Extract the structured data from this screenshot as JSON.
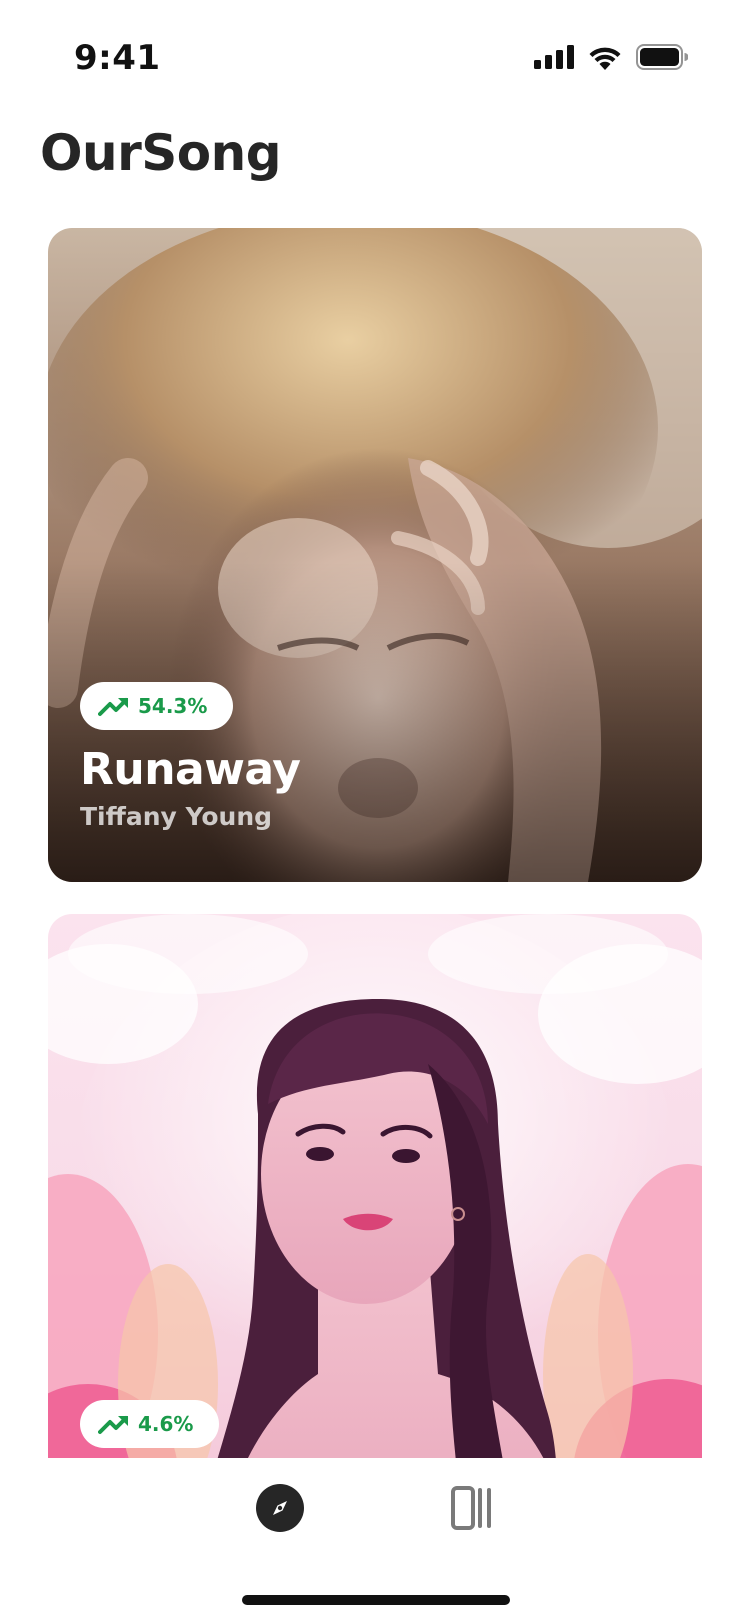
{
  "status_bar": {
    "time": "9:41",
    "icons": [
      "cellular-signal-icon",
      "wifi-icon",
      "battery-icon"
    ]
  },
  "app": {
    "title": "OurSong"
  },
  "cards": [
    {
      "title": "Runaway",
      "artist": "Tiffany Young",
      "trend": "54.3%",
      "trend_icon": "trending-up-icon",
      "artwork": "album-artwork-photo"
    },
    {
      "trend": "4.6%",
      "trend_icon": "trending-up-icon",
      "artwork": "album-artwork-illustration"
    }
  ],
  "tab_bar": {
    "items": [
      {
        "icon": "compass-icon",
        "active": true
      },
      {
        "icon": "library-icon",
        "active": false
      }
    ]
  },
  "colors": {
    "trend_green": "#1a9a4a",
    "title_dark": "#262626",
    "active_tab": "#262626",
    "inactive_tab": "#7a7a7a"
  }
}
